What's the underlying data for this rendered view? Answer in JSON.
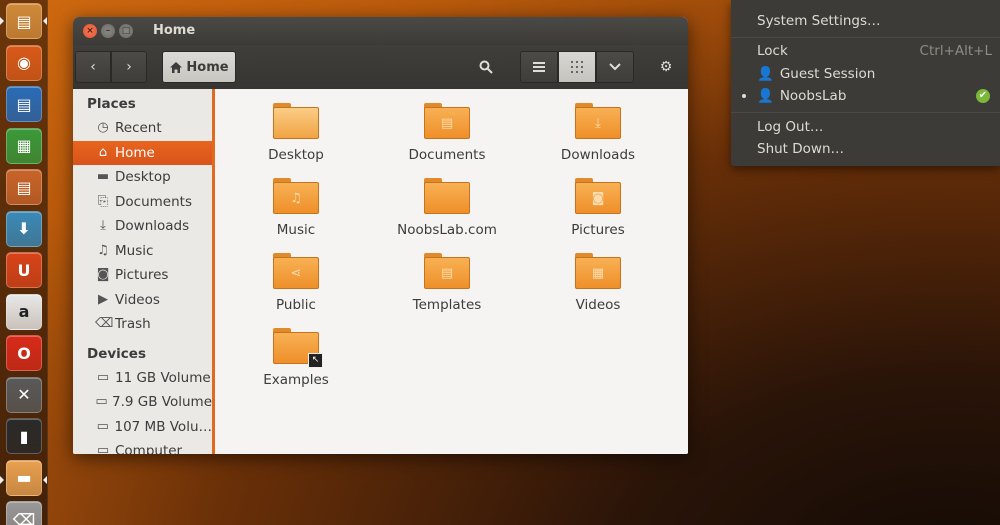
{
  "window": {
    "title": "Home",
    "close": "×",
    "min": "–",
    "max": "□"
  },
  "toolbar": {
    "back": "‹",
    "forward": "›",
    "path_home": "Home",
    "search": "⌕",
    "view_list": "☰",
    "view_grid": "⁞⁞⁞",
    "view_menu": "⌄",
    "settings": "⚙"
  },
  "sidebar": {
    "places_heading": "Places",
    "places": [
      {
        "label": "Recent",
        "icon": "◷",
        "icon_name": "clock-icon"
      },
      {
        "label": "Home",
        "icon": "⌂",
        "icon_name": "home-icon",
        "active": true
      },
      {
        "label": "Desktop",
        "icon": "▬",
        "icon_name": "desktop-icon"
      },
      {
        "label": "Documents",
        "icon": "⎘",
        "icon_name": "documents-icon"
      },
      {
        "label": "Downloads",
        "icon": "⤓",
        "icon_name": "download-icon"
      },
      {
        "label": "Music",
        "icon": "♫",
        "icon_name": "music-icon"
      },
      {
        "label": "Pictures",
        "icon": "◙",
        "icon_name": "camera-icon"
      },
      {
        "label": "Videos",
        "icon": "▶",
        "icon_name": "video-icon"
      },
      {
        "label": "Trash",
        "icon": "⌫",
        "icon_name": "trash-icon"
      }
    ],
    "devices_heading": "Devices",
    "devices": [
      {
        "label": "11 GB Volume",
        "icon": "▭",
        "icon_name": "drive-icon"
      },
      {
        "label": "7.9 GB Volume",
        "icon": "▭",
        "icon_name": "drive-icon"
      },
      {
        "label": "107 MB Volu…",
        "icon": "▭",
        "icon_name": "drive-icon"
      },
      {
        "label": "Computer",
        "icon": "▭",
        "icon_name": "computer-icon"
      }
    ]
  },
  "files": [
    {
      "label": "Desktop",
      "glyph": "",
      "kind": "desktop"
    },
    {
      "label": "Documents",
      "glyph": "▤",
      "kind": "folder"
    },
    {
      "label": "Downloads",
      "glyph": "⤓",
      "kind": "folder"
    },
    {
      "label": "Music",
      "glyph": "♫",
      "kind": "folder"
    },
    {
      "label": "NoobsLab.com",
      "glyph": "",
      "kind": "folder"
    },
    {
      "label": "Pictures",
      "glyph": "◙",
      "kind": "folder"
    },
    {
      "label": "Public",
      "glyph": "⋖",
      "kind": "folder"
    },
    {
      "label": "Templates",
      "glyph": "▤",
      "kind": "folder"
    },
    {
      "label": "Videos",
      "glyph": "▦",
      "kind": "folder"
    },
    {
      "label": "Examples",
      "glyph": "",
      "kind": "link",
      "emblem": "↖"
    }
  ],
  "session_menu": {
    "system_settings": "System Settings…",
    "lock": "Lock",
    "lock_shortcut": "Ctrl+Alt+L",
    "guest_session": "Guest Session",
    "current_user": "NoobsLab",
    "log_out": "Log Out…",
    "shut_down": "Shut Down…",
    "user_icon": "👤",
    "check": "✔"
  },
  "launcher": [
    {
      "name": "files-launcher",
      "glyph": "▤",
      "color": "#d08a3a"
    },
    {
      "name": "firefox-launcher",
      "glyph": "◉",
      "color": "#d85a1a"
    },
    {
      "name": "writer-launcher",
      "glyph": "▤",
      "color": "#2a6cb8"
    },
    {
      "name": "calc-launcher",
      "glyph": "▦",
      "color": "#3a9a3a"
    },
    {
      "name": "impress-launcher",
      "glyph": "▤",
      "color": "#c8642a"
    },
    {
      "name": "software-center-launcher",
      "glyph": "⬇",
      "color": "#3a8ab8"
    },
    {
      "name": "ubuntu-one-launcher",
      "glyph": "U",
      "color": "#d8441a"
    },
    {
      "name": "amazon-launcher",
      "glyph": "a",
      "color": "#e8e8e8"
    },
    {
      "name": "opera-launcher",
      "glyph": "O",
      "color": "#d82a1a"
    },
    {
      "name": "system-tools-launcher",
      "glyph": "✕",
      "color": "#5a5a5a"
    },
    {
      "name": "terminal-launcher",
      "glyph": "▮",
      "color": "#2a2a2a"
    },
    {
      "name": "home-folder-launcher",
      "glyph": "▬",
      "color": "#e8a050"
    },
    {
      "name": "trash-launcher",
      "glyph": "⌫",
      "color": "#999999"
    }
  ]
}
